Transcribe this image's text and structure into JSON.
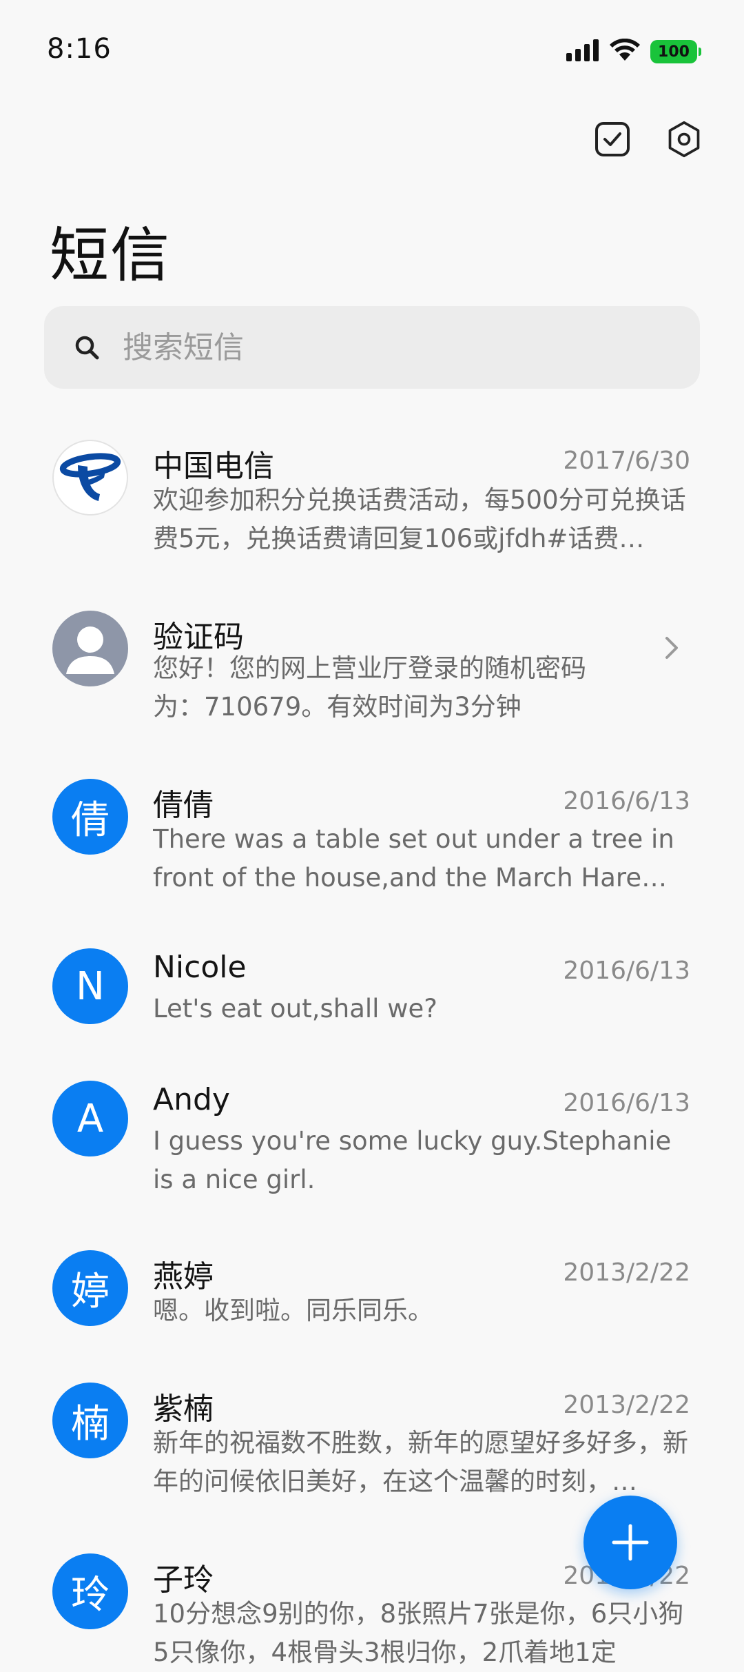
{
  "status_bar": {
    "time": "8:16",
    "battery": "100",
    "icons": [
      "signal-icon",
      "wifi-icon",
      "battery-icon"
    ]
  },
  "toolbar": {
    "icons": [
      "checklist-icon",
      "settings-icon"
    ]
  },
  "header": {
    "title": "短信"
  },
  "search": {
    "placeholder": "搜索短信"
  },
  "messages": [
    {
      "name": "中国电信",
      "date": "2017/6/30",
      "preview": "欢迎参加积分兑换话费活动，每500分可兑换话费5元，兑换话费请回复106或jfdh#话费…",
      "avatar": "telecom-logo"
    },
    {
      "name": "验证码",
      "date": "",
      "preview": "您好！您的网上营业厅登录的随机密码为：710679。有效时间为3分钟",
      "avatar": "person-icon"
    },
    {
      "name": "倩倩",
      "date": "2016/6/13",
      "preview": "There was a table set out under a tree in front of the house,and the March Hare an…",
      "avatar": "倩"
    },
    {
      "name": "Nicole",
      "date": "2016/6/13",
      "preview": "Let's eat out,shall we?",
      "avatar": "N"
    },
    {
      "name": "Andy",
      "date": "2016/6/13",
      "preview": "I guess you're some lucky guy.Stephanie is a nice girl.",
      "avatar": "A"
    },
    {
      "name": "燕婷",
      "date": "2013/2/22",
      "preview": "嗯。收到啦。同乐同乐。",
      "avatar": "婷"
    },
    {
      "name": "紫楠",
      "date": "2013/2/22",
      "preview": "新年的祝福数不胜数，新年的愿望好多好多，新年的问候依旧美好，在这个温馨的时刻，…",
      "avatar": "楠"
    },
    {
      "name": "子玲",
      "date": "2013/2/22",
      "preview": "10分想念9别的你，8张照片7张是你，6只小狗5只像你，4根骨头3根归你，2爪着地1定",
      "avatar": "玲"
    }
  ],
  "colors": {
    "accent": "#0a7ef2",
    "battery": "#19c33a",
    "background": "#f8f8f8",
    "search_bg": "#ececec"
  }
}
